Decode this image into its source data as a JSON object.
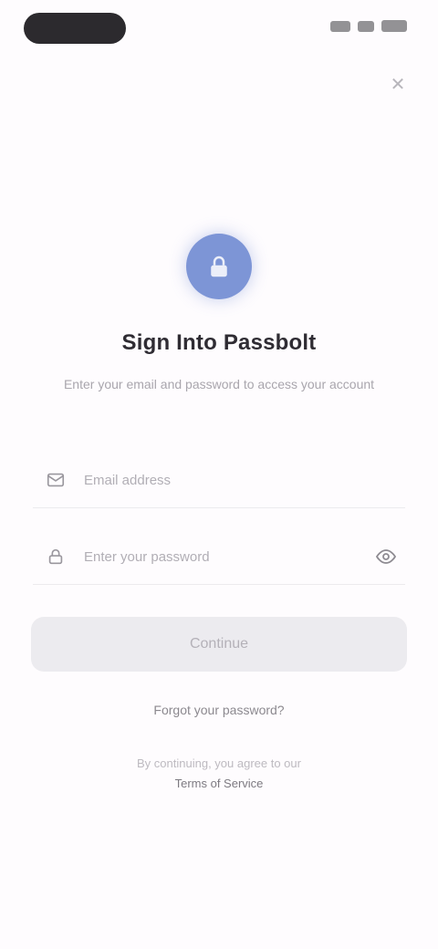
{
  "status_bar": {
    "signal_icon": "signal-icon",
    "wifi_icon": "wifi-icon",
    "battery_icon": "battery-icon"
  },
  "close_glyph": "✕",
  "header": {
    "icon": "lock-icon",
    "title": "Sign Into Passbolt",
    "subtitle": "Enter your email and password to access your account"
  },
  "form": {
    "email_placeholder": "Email address",
    "password_placeholder": "Enter your password",
    "submit_label": "Continue"
  },
  "forgot_label": "Forgot your password?",
  "footer": {
    "text": "By continuing, you agree to our",
    "link": "Terms of Service"
  },
  "colors": {
    "accent": "#7d95d6",
    "background": "#fefcfe",
    "button_disabled": "#ecebef"
  }
}
